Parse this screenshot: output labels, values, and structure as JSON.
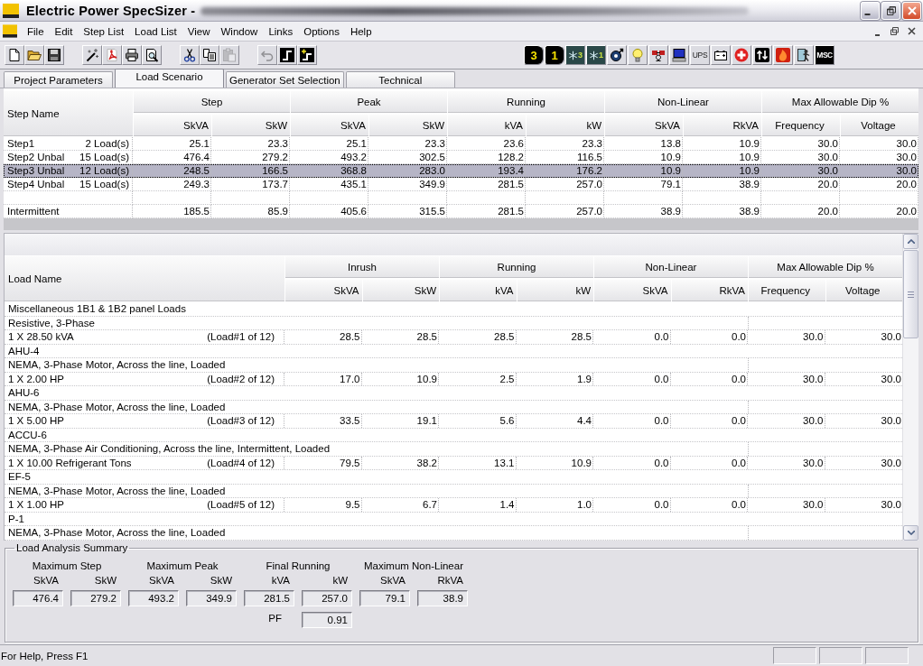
{
  "window": {
    "title": "Electric Power SpecSizer -"
  },
  "menu_bar": {
    "items": [
      "File",
      "Edit",
      "Step List",
      "Load List",
      "View",
      "Window",
      "Links",
      "Options",
      "Help"
    ]
  },
  "toolbar": {
    "left": [
      [
        {
          "kind": "new",
          "disabled": false
        },
        {
          "kind": "open",
          "disabled": false
        },
        {
          "kind": "save",
          "disabled": false
        }
      ],
      [
        {
          "kind": "wand",
          "disabled": false
        },
        {
          "kind": "pdf",
          "disabled": false
        },
        {
          "kind": "print",
          "disabled": false
        },
        {
          "kind": "preview",
          "disabled": false
        }
      ],
      [
        {
          "kind": "cut",
          "disabled": false
        },
        {
          "kind": "copy",
          "disabled": false
        },
        {
          "kind": "paste",
          "disabled": true
        }
      ],
      [
        {
          "kind": "undo",
          "disabled": true
        },
        {
          "kind": "step",
          "disabled": false
        },
        {
          "kind": "stepplus",
          "disabled": false
        }
      ]
    ],
    "right": [
      {
        "kind": "plug",
        "label": "3",
        "disabled": false
      },
      {
        "kind": "plug",
        "label": "1",
        "disabled": false
      },
      {
        "kind": "snow",
        "label": "3",
        "disabled": false
      },
      {
        "kind": "snow",
        "label": "1",
        "disabled": false
      },
      {
        "kind": "motor",
        "disabled": false
      },
      {
        "kind": "bulb",
        "disabled": false
      },
      {
        "kind": "resistor",
        "disabled": false
      },
      {
        "kind": "computer",
        "disabled": false
      },
      {
        "kind": "text",
        "label": "UPS",
        "disabled": false
      },
      {
        "kind": "battery",
        "disabled": false
      },
      {
        "kind": "medical",
        "disabled": false
      },
      {
        "kind": "arrows",
        "disabled": false
      },
      {
        "kind": "flame",
        "disabled": false
      },
      {
        "kind": "exit",
        "disabled": false
      },
      {
        "kind": "badge",
        "label": "MSC",
        "disabled": false
      }
    ]
  },
  "tabs": [
    {
      "label": "Project Parameters",
      "selected": false
    },
    {
      "label": "Load Scenario",
      "selected": true
    },
    {
      "label": "Generator Set Selection",
      "selected": false
    },
    {
      "label": "Technical",
      "selected": false
    }
  ],
  "step_table": {
    "name_header": "Step Name",
    "groups": [
      {
        "label": "Step",
        "columns": [
          "SkVA",
          "SkW"
        ]
      },
      {
        "label": "Peak",
        "columns": [
          "SkVA",
          "SkW"
        ]
      },
      {
        "label": "Running",
        "columns": [
          "kVA",
          "kW"
        ]
      },
      {
        "label": "Non-Linear",
        "columns": [
          "SkVA",
          "RkVA"
        ]
      },
      {
        "label": "Max Allowable Dip %",
        "columns": [
          "Frequency",
          "Voltage"
        ]
      }
    ],
    "rows": [
      {
        "kind": "data",
        "name": "Step1",
        "loads": "2 Load(s)",
        "values": [
          "25.1",
          "23.3",
          "25.1",
          "23.3",
          "23.6",
          "23.3",
          "13.8",
          "10.9",
          "30.0",
          "30.0"
        ],
        "selected": false
      },
      {
        "kind": "data",
        "name": "Step2 Unbal",
        "loads": "15 Load(s)",
        "values": [
          "476.4",
          "279.2",
          "493.2",
          "302.5",
          "128.2",
          "116.5",
          "10.9",
          "10.9",
          "30.0",
          "30.0"
        ],
        "selected": false
      },
      {
        "kind": "data",
        "name": "Step3 Unbal",
        "loads": "12 Load(s)",
        "values": [
          "248.5",
          "166.5",
          "368.8",
          "283.0",
          "193.4",
          "176.2",
          "10.9",
          "10.9",
          "30.0",
          "30.0"
        ],
        "selected": true
      },
      {
        "kind": "data",
        "name": "Step4 Unbal",
        "loads": "15 Load(s)",
        "values": [
          "249.3",
          "173.7",
          "435.1",
          "349.9",
          "281.5",
          "257.0",
          "79.1",
          "38.9",
          "20.0",
          "20.0"
        ],
        "selected": false
      },
      {
        "kind": "blank",
        "selected": false
      },
      {
        "kind": "data",
        "name": "Intermittent",
        "values": [
          "185.5",
          "85.9",
          "405.6",
          "315.5",
          "281.5",
          "257.0",
          "38.9",
          "38.9",
          "20.0",
          "20.0"
        ],
        "selected": false
      }
    ]
  },
  "load_table": {
    "name_header": "Load Name",
    "groups": [
      {
        "label": "Inrush",
        "columns": [
          "SkVA",
          "SkW"
        ]
      },
      {
        "label": "Running",
        "columns": [
          "kVA",
          "kW"
        ]
      },
      {
        "label": "Non-Linear",
        "columns": [
          "SkVA",
          "RkVA"
        ]
      },
      {
        "label": "Max Allowable Dip %",
        "columns": [
          "Frequency",
          "Voltage"
        ]
      }
    ],
    "loads": [
      {
        "name": "Miscellaneous 1B1 & 1B2 panel Loads",
        "description": "Resistive, 3-Phase",
        "quantity": "1 X 28.50 kVA",
        "count": "(Load#1 of 12)",
        "values": [
          "28.5",
          "28.5",
          "28.5",
          "28.5",
          "0.0",
          "0.0",
          "30.0",
          "30.0"
        ]
      },
      {
        "name": "AHU-4",
        "description": "NEMA, 3-Phase Motor, Across the line, Loaded",
        "quantity": "1 X 2.00 HP",
        "count": "(Load#2 of 12)",
        "values": [
          "17.0",
          "10.9",
          "2.5",
          "1.9",
          "0.0",
          "0.0",
          "30.0",
          "30.0"
        ]
      },
      {
        "name": "AHU-6",
        "description": "NEMA, 3-Phase Motor, Across the line, Loaded",
        "quantity": "1 X 5.00 HP",
        "count": "(Load#3 of 12)",
        "values": [
          "33.5",
          "19.1",
          "5.6",
          "4.4",
          "0.0",
          "0.0",
          "30.0",
          "30.0"
        ]
      },
      {
        "name": "ACCU-6",
        "description": "NEMA, 3-Phase Air Conditioning, Across the line, Intermittent, Loaded",
        "quantity": "1 X 10.00 Refrigerant Tons",
        "count": "(Load#4 of 12)",
        "values": [
          "79.5",
          "38.2",
          "13.1",
          "10.9",
          "0.0",
          "0.0",
          "30.0",
          "30.0"
        ]
      },
      {
        "name": "EF-5",
        "description": "NEMA, 3-Phase Motor, Across the line, Loaded",
        "quantity": "1 X 1.00 HP",
        "count": "(Load#5 of 12)",
        "values": [
          "9.5",
          "6.7",
          "1.4",
          "1.0",
          "0.0",
          "0.0",
          "30.0",
          "30.0"
        ]
      },
      {
        "name": "P-1",
        "description": "NEMA, 3-Phase Motor, Across the line, Loaded"
      }
    ]
  },
  "summary": {
    "title": "Load Analysis Summary",
    "groups": [
      {
        "label": "Maximum Step",
        "fields": [
          {
            "label": "SkVA",
            "value": "476.4"
          },
          {
            "label": "SkW",
            "value": "279.2"
          }
        ]
      },
      {
        "label": "Maximum Peak",
        "fields": [
          {
            "label": "SkVA",
            "value": "493.2"
          },
          {
            "label": "SkW",
            "value": "349.9"
          }
        ]
      },
      {
        "label": "Final Running",
        "fields": [
          {
            "label": "kVA",
            "value": "281.5"
          },
          {
            "label": "kW",
            "value": "257.0"
          }
        ]
      },
      {
        "label": "Maximum Non-Linear",
        "fields": [
          {
            "label": "SkVA",
            "value": "79.1"
          },
          {
            "label": "RkVA",
            "value": "38.9"
          }
        ]
      }
    ],
    "pf": {
      "label": "PF",
      "value": "0.91"
    }
  },
  "status_bar": {
    "text": "For Help, Press F1"
  }
}
